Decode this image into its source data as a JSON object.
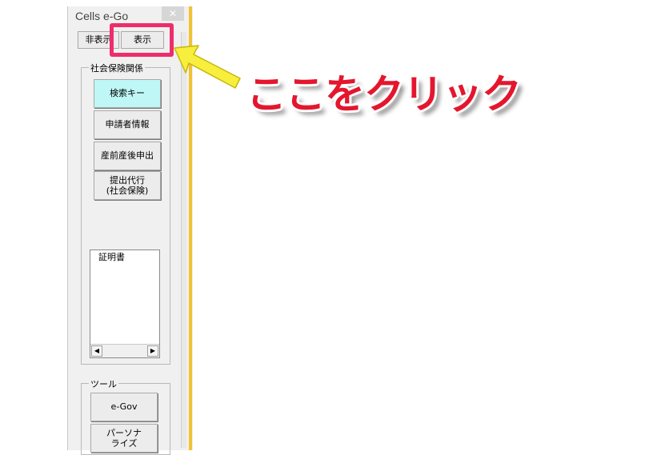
{
  "panel": {
    "title": "Cells e-Go",
    "close_symbol": "✕",
    "hide_button": "非表示",
    "show_button": "表示",
    "social_insurance": {
      "group_label": "社会保険関係",
      "search_key": "検索キー",
      "applicant_info": "申請者情報",
      "maternity": "産前産後申出",
      "submission_line1": "提出代行",
      "submission_line2": "(社会保険)"
    },
    "list": {
      "items": [
        "証明書"
      ],
      "left_arrow": "◀",
      "right_arrow": "▶"
    },
    "tools": {
      "group_label": "ツール",
      "egov": "e-Gov",
      "personalize_line1": "パーソナ",
      "personalize_line2": "ライズ"
    }
  },
  "annotation": {
    "text": "ここをクリック"
  },
  "colors": {
    "highlight": "#ee2d6b",
    "callout_text": "#e4162e",
    "arrow_fill": "#f7ee3d",
    "selected_button": "#bff7f7",
    "pane_edge": "#f2c230"
  }
}
